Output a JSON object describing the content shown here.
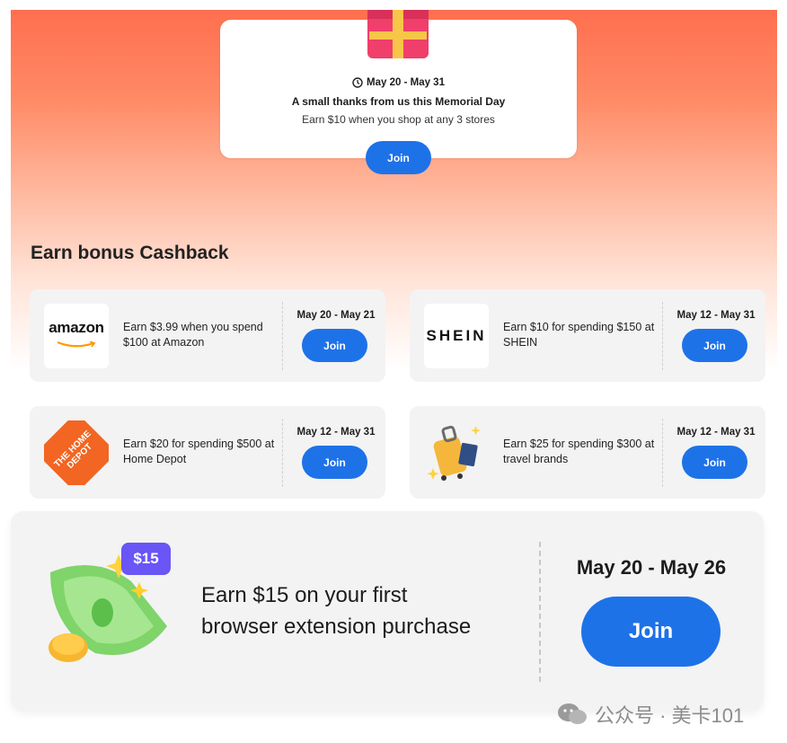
{
  "promo": {
    "date": "May 20 - May 31",
    "title": "A small thanks from us this Memorial Day",
    "subtitle": "Earn $10 when you shop at any 3 stores",
    "join_label": "Join"
  },
  "section_title": "Earn bonus Cashback",
  "offers": [
    {
      "store": "amazon",
      "logo_text": "amazon",
      "description": "Earn $3.99 when you spend $100 at Amazon",
      "date": "May 20 - May 21",
      "join_label": "Join"
    },
    {
      "store": "shein",
      "logo_text": "SHEIN",
      "description": "Earn $10 for spending $150 at SHEIN",
      "date": "May 12 - May 31",
      "join_label": "Join"
    },
    {
      "store": "home-depot",
      "logo_text": "THE HOME DEPOT",
      "description": "Earn $20 for spending $500 at Home Depot",
      "date": "May 12 - May 31",
      "join_label": "Join"
    },
    {
      "store": "travel",
      "logo_text": "",
      "description": "Earn $25 for spending $300 at travel brands",
      "date": "May 12 - May 31",
      "join_label": "Join"
    }
  ],
  "extension": {
    "badge": "$15",
    "title_line1": "Earn $15 on your first",
    "title_line2": "browser extension purchase",
    "date": "May 20 - May 26",
    "join_label": "Join"
  },
  "watermark": "公众号 · 美卡101",
  "colors": {
    "accent": "#1e72e8",
    "hero_top": "#ff6f4f",
    "badge": "#6a55f7"
  }
}
